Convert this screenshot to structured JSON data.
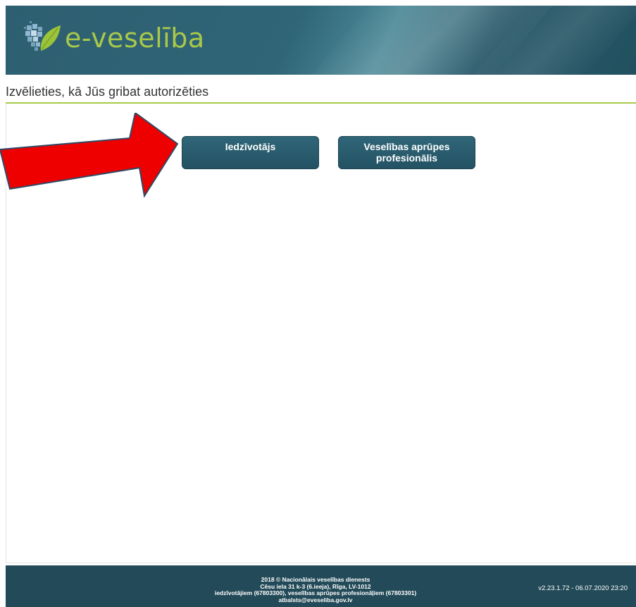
{
  "header": {
    "logo_text": "e-veselība",
    "colors": {
      "bar": "#2d5f70",
      "logo_text": "#a9c84a",
      "leaf": "#9cc43a",
      "heart": "#7aa9c6"
    }
  },
  "main": {
    "title": "Izvēlieties, kā Jūs gribat autorizēties",
    "buttons": {
      "resident": "Iedzīvotājs",
      "professional_line1": "Veselības aprūpes",
      "professional_line2": "profesionālis"
    }
  },
  "annotation": {
    "arrow_color": "#ee0000",
    "arrow_target": "Iedzīvotājs"
  },
  "footer": {
    "line1": "2018 © Nacionālais veselības dienests",
    "line2": "Cēsu iela 31 k-3 (6.ieeja), Rīga, LV-1012",
    "line3": "iedzīvotājiem (67803300), veselības aprūpes profesionāļiem (67803301)",
    "line4": "atbalsts@eveseliba.gov.lv",
    "version": "v2.23.1.72 - 06.07.2020 23:20"
  }
}
